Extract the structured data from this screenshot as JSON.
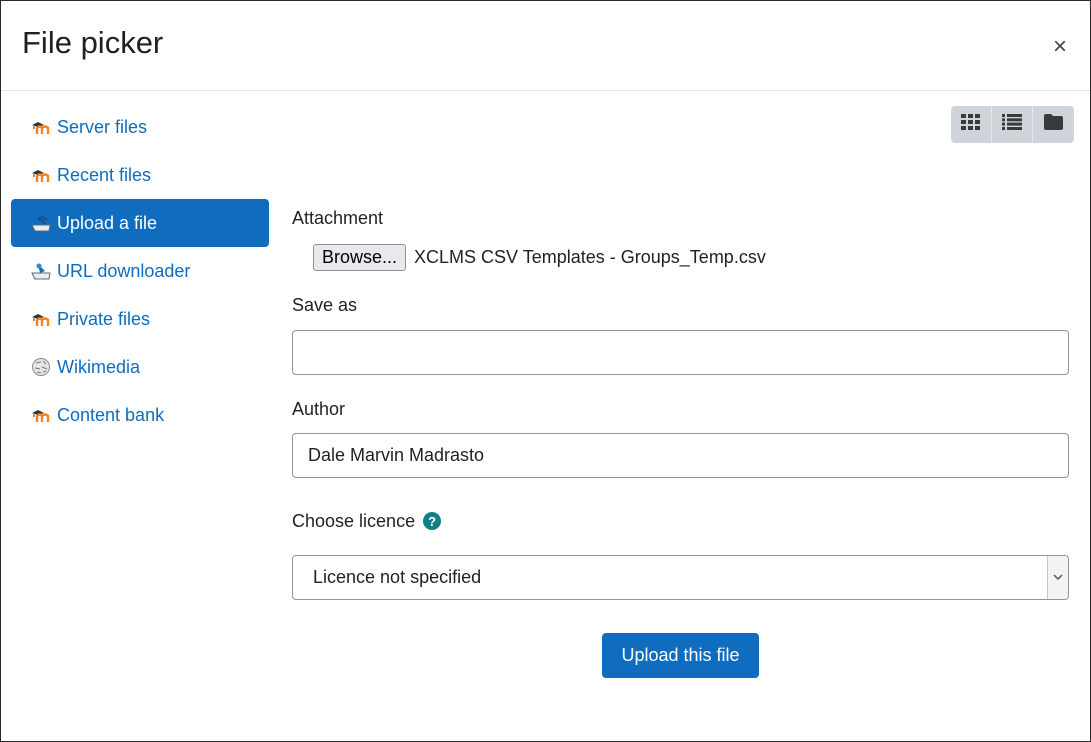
{
  "dialog": {
    "title": "File picker",
    "close_label": "×"
  },
  "sidebar": {
    "items": [
      {
        "label": "Server files",
        "icon": "moodle-icon",
        "active": false
      },
      {
        "label": "Recent files",
        "icon": "moodle-icon",
        "active": false
      },
      {
        "label": "Upload a file",
        "icon": "upload-icon",
        "active": true
      },
      {
        "label": "URL downloader",
        "icon": "url-download-icon",
        "active": false
      },
      {
        "label": "Private files",
        "icon": "moodle-icon",
        "active": false
      },
      {
        "label": "Wikimedia",
        "icon": "wikimedia-icon",
        "active": false
      },
      {
        "label": "Content bank",
        "icon": "moodle-icon",
        "active": false
      }
    ]
  },
  "toolbar": {
    "views": [
      {
        "name": "icons-view",
        "icon": "grid-icon"
      },
      {
        "name": "list-view",
        "icon": "list-icon"
      },
      {
        "name": "tree-view",
        "icon": "folder-icon"
      }
    ]
  },
  "form": {
    "attachment_label": "Attachment",
    "browse_label": "Browse...",
    "file_name": "XCLMS CSV Templates - Groups_Temp.csv",
    "save_as_label": "Save as",
    "save_as_value": "",
    "author_label": "Author",
    "author_value": "Dale Marvin Madrasto",
    "licence_label": "Choose licence",
    "help_glyph": "?",
    "licence_value": "Licence not specified",
    "submit_label": "Upload this file"
  },
  "colors": {
    "primary": "#0f6cbf",
    "help": "#0f8088",
    "moodle_orange": "#f98012"
  }
}
